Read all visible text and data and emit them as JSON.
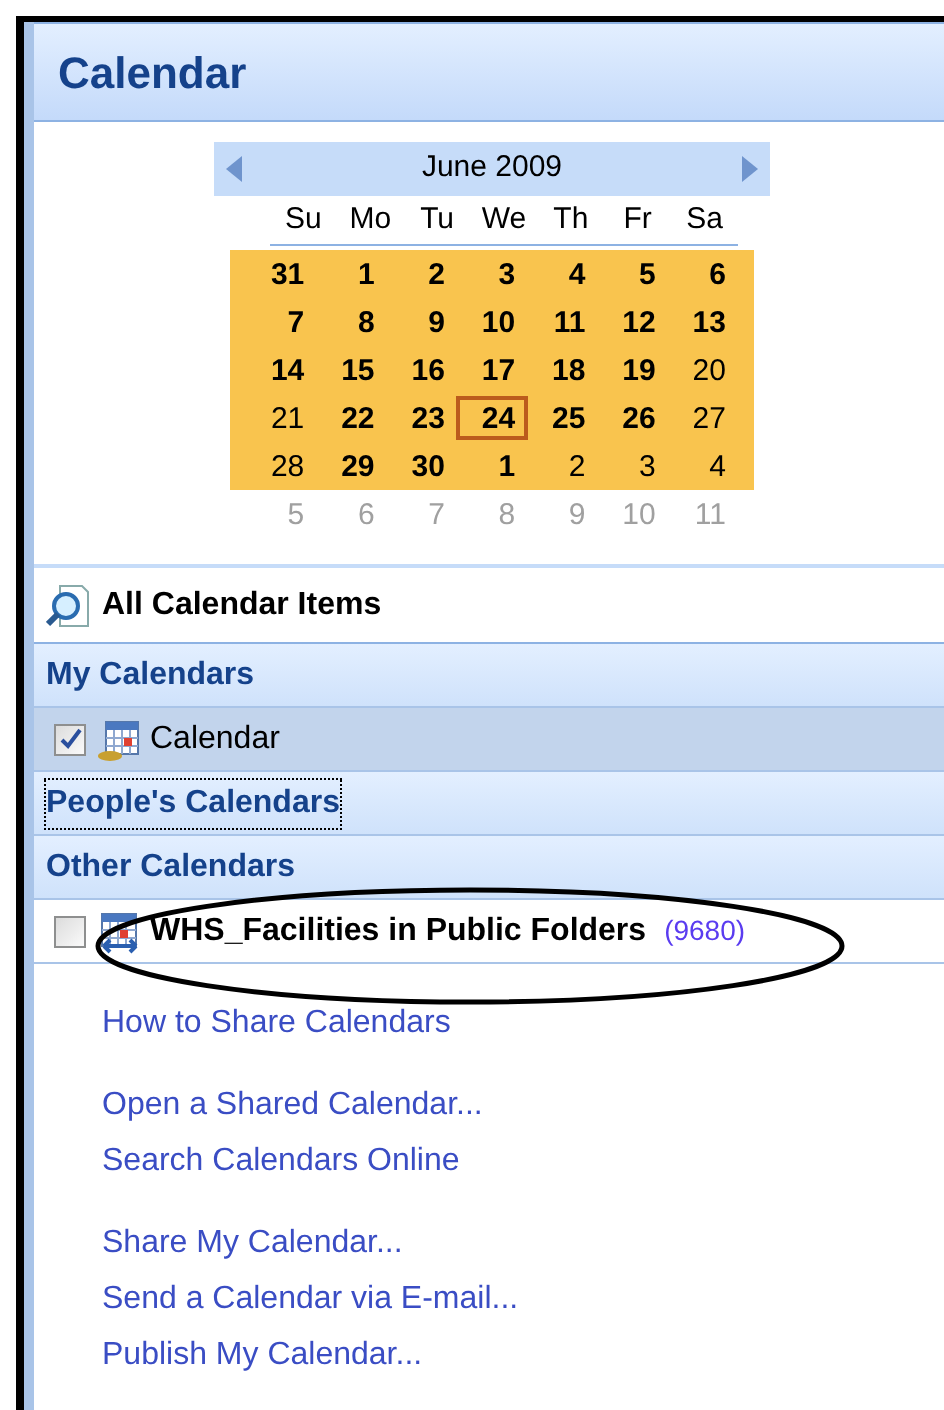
{
  "header": {
    "title": "Calendar"
  },
  "date_navigator": {
    "month": "June 2009",
    "weekdays": [
      "Su",
      "Mo",
      "Tu",
      "We",
      "Th",
      "Fr",
      "Sa"
    ],
    "weeks": [
      {
        "selected": true,
        "days": [
          {
            "day": "31",
            "bold": true,
            "today": false
          },
          {
            "day": "1",
            "bold": true,
            "today": false
          },
          {
            "day": "2",
            "bold": true,
            "today": false
          },
          {
            "day": "3",
            "bold": true,
            "today": false
          },
          {
            "day": "4",
            "bold": true,
            "today": false
          },
          {
            "day": "5",
            "bold": true,
            "today": false
          },
          {
            "day": "6",
            "bold": true,
            "today": false
          }
        ]
      },
      {
        "selected": true,
        "days": [
          {
            "day": "7",
            "bold": true,
            "today": false
          },
          {
            "day": "8",
            "bold": true,
            "today": false
          },
          {
            "day": "9",
            "bold": true,
            "today": false
          },
          {
            "day": "10",
            "bold": true,
            "today": false
          },
          {
            "day": "11",
            "bold": true,
            "today": false
          },
          {
            "day": "12",
            "bold": true,
            "today": false
          },
          {
            "day": "13",
            "bold": true,
            "today": false
          }
        ]
      },
      {
        "selected": true,
        "days": [
          {
            "day": "14",
            "bold": true,
            "today": false
          },
          {
            "day": "15",
            "bold": true,
            "today": false
          },
          {
            "day": "16",
            "bold": true,
            "today": false
          },
          {
            "day": "17",
            "bold": true,
            "today": false
          },
          {
            "day": "18",
            "bold": true,
            "today": false
          },
          {
            "day": "19",
            "bold": true,
            "today": false
          },
          {
            "day": "20",
            "bold": false,
            "today": false
          }
        ]
      },
      {
        "selected": true,
        "days": [
          {
            "day": "21",
            "bold": false,
            "today": false
          },
          {
            "day": "22",
            "bold": true,
            "today": false
          },
          {
            "day": "23",
            "bold": true,
            "today": false
          },
          {
            "day": "24",
            "bold": true,
            "today": true
          },
          {
            "day": "25",
            "bold": true,
            "today": false
          },
          {
            "day": "26",
            "bold": true,
            "today": false
          },
          {
            "day": "27",
            "bold": false,
            "today": false
          }
        ]
      },
      {
        "selected": true,
        "days": [
          {
            "day": "28",
            "bold": false,
            "today": false
          },
          {
            "day": "29",
            "bold": true,
            "today": false
          },
          {
            "day": "30",
            "bold": true,
            "today": false
          },
          {
            "day": "1",
            "bold": true,
            "today": false
          },
          {
            "day": "2",
            "bold": false,
            "today": false
          },
          {
            "day": "3",
            "bold": false,
            "today": false
          },
          {
            "day": "4",
            "bold": false,
            "today": false
          }
        ]
      },
      {
        "selected": false,
        "days": [
          {
            "day": "5",
            "bold": false,
            "today": false
          },
          {
            "day": "6",
            "bold": false,
            "today": false
          },
          {
            "day": "7",
            "bold": false,
            "today": false
          },
          {
            "day": "8",
            "bold": false,
            "today": false
          },
          {
            "day": "9",
            "bold": false,
            "today": false
          },
          {
            "day": "10",
            "bold": false,
            "today": false
          },
          {
            "day": "11",
            "bold": false,
            "today": false
          }
        ]
      }
    ]
  },
  "all_items": {
    "label": "All Calendar Items"
  },
  "groups": [
    {
      "title": "My Calendars",
      "focused": false,
      "items": [
        {
          "label": "Calendar",
          "checked": true,
          "selected": true,
          "kind": "personal"
        }
      ]
    },
    {
      "title": "People's Calendars",
      "focused": true
    },
    {
      "title": "Other Calendars",
      "focused": false,
      "items": [
        {
          "label": "WHS_Facilities in Public Folders",
          "count": "(9680)",
          "checked": false,
          "selected": false,
          "kind": "shared"
        }
      ]
    }
  ],
  "link_groups": [
    [
      "How to Share Calendars"
    ],
    [
      "Open a Shared Calendar...",
      "Search Calendars Online"
    ],
    [
      "Share My Calendar...",
      "Send a Calendar via E-mail...",
      "Publish My Calendar..."
    ]
  ]
}
